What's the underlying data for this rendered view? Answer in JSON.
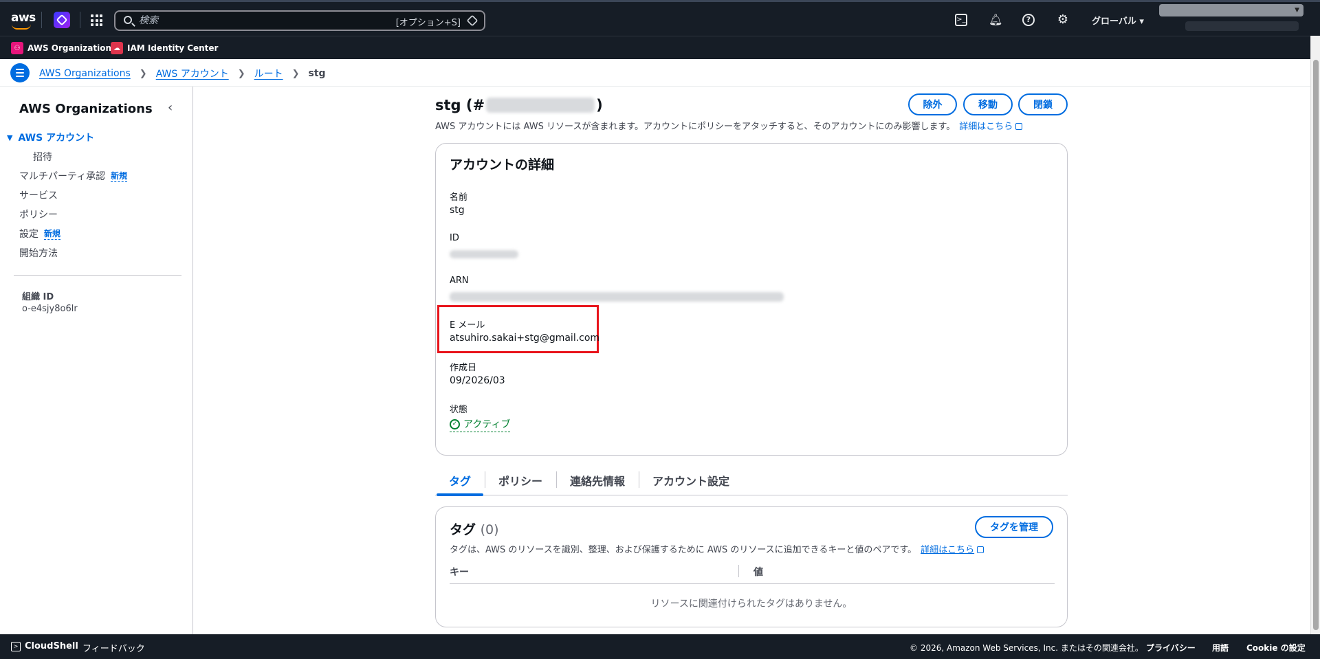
{
  "topnav": {
    "logo": "aws",
    "search_placeholder": "検索",
    "search_shortcut": "[オプション+S]",
    "region": "グローバル ▾",
    "icons": [
      "cloudshell-icon",
      "bell-icon",
      "help-icon",
      "gear-icon"
    ]
  },
  "favorites": [
    {
      "label": "AWS Organizations",
      "icon": "organizations-icon"
    },
    {
      "label": "IAM Identity Center",
      "icon": "iam-identity-center-icon"
    }
  ],
  "breadcrumb": {
    "items": [
      "AWS Organizations",
      "AWS アカウント",
      "ルート"
    ],
    "current": "stg"
  },
  "sidebar": {
    "title": "AWS Organizations",
    "items": [
      {
        "label": "AWS アカウント",
        "active": true
      },
      {
        "label": "招待"
      },
      {
        "label": "マルチパーティ承認",
        "badge": "新規"
      },
      {
        "label": "サービス"
      },
      {
        "label": "ポリシー"
      },
      {
        "label": "設定",
        "badge": "新規"
      },
      {
        "label": "開始方法"
      }
    ],
    "org_id_label": "組織 ID",
    "org_id_value": "o-e4sjy8o6lr"
  },
  "page": {
    "title_prefix": "stg (#",
    "title_suffix": ")",
    "description": "AWS アカウントには AWS リソースが含まれます。アカウントにポリシーをアタッチすると、そのアカウントにのみ影響します。",
    "learn_more": "詳細はこちら",
    "buttons": {
      "remove": "除外",
      "move": "移動",
      "close": "閉鎖"
    }
  },
  "account_details": {
    "title": "アカウントの詳細",
    "name_label": "名前",
    "name_value": "stg",
    "id_label": "ID",
    "arn_label": "ARN",
    "email_label": "E メール",
    "email_value": "atsuhiro.sakai+stg@gmail.com",
    "created_label": "作成日",
    "created_value": "09/2026/03",
    "status_label": "状態",
    "status_value": "アクティブ"
  },
  "tabs": [
    "タグ",
    "ポリシー",
    "連絡先情報",
    "アカウント設定"
  ],
  "tags_panel": {
    "title": "タグ",
    "count": "(0)",
    "manage_button": "タグを管理",
    "description": "タグは、AWS のリソースを識別、整理、および保護するために AWS のリソースに追加できるキーと値のペアです。",
    "learn_more": "詳細はこちら",
    "col_key": "キー",
    "col_value": "値",
    "empty": "リソースに関連付けられたタグはありません。"
  },
  "footer": {
    "cloudshell": "CloudShell",
    "feedback": "フィードバック",
    "copyright": "© 2026, Amazon Web Services, Inc. またはその関連会社。",
    "privacy": "プライバシー",
    "terms": "用語",
    "cookie": "Cookie の設定"
  },
  "colors": {
    "accent": "#006ce0",
    "highlight": "#e8141b",
    "success": "#00802f",
    "nav_bg": "#161d26"
  }
}
